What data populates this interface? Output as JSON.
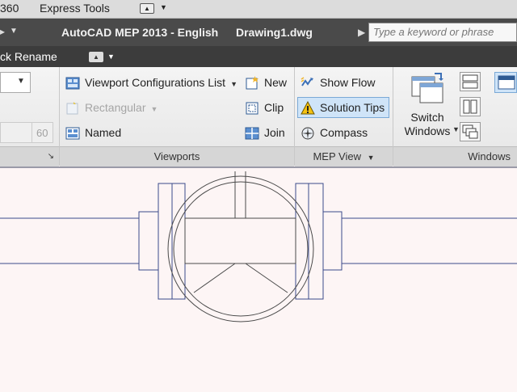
{
  "menubar": {
    "item_360": "360",
    "express_tools": "Express Tools"
  },
  "titlebar": {
    "app_title": "AutoCAD MEP 2013 - English",
    "doc_title": "Drawing1.dwg",
    "search_placeholder": "Type a keyword or phrase"
  },
  "quick_toolbar": {
    "label": "ck Rename"
  },
  "ribbon": {
    "left_panel": {
      "field_value": "60"
    },
    "viewports": {
      "title": "Viewports",
      "config_list": "Viewport Configurations List",
      "rectangular": "Rectangular",
      "named": "Named",
      "new": "New",
      "clip": "Clip",
      "join": "Join"
    },
    "mep_view": {
      "title": "MEP View",
      "show_flow": "Show Flow",
      "solution_tips": "Solution Tips",
      "compass": "Compass"
    },
    "windows": {
      "title": "Windows",
      "switch_windows_line1": "Switch",
      "switch_windows_line2": "Windows"
    }
  },
  "colors": {
    "accent_blue": "#3b6fb6",
    "drawing_line": "#3a4a8a",
    "title_bar": "#4a4a4a"
  }
}
